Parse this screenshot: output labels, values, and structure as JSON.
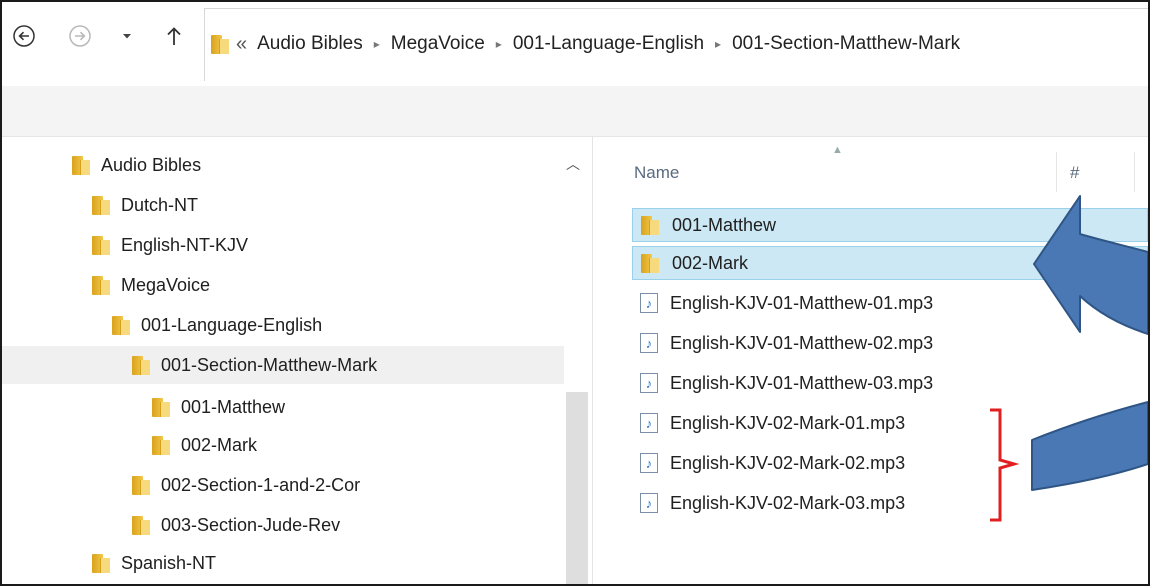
{
  "window": {
    "address": {
      "overflow_chevrons": "«",
      "crumbs": [
        "Audio Bibles",
        "MegaVoice",
        "001-Language-English",
        "001-Section-Matthew-Mark"
      ],
      "separator": "▸"
    }
  },
  "nav": {
    "back_icon": "back-arrow-icon",
    "forward_icon": "forward-arrow-icon",
    "recent_icon": "chevron-down-icon",
    "up_icon": "up-arrow-icon"
  },
  "tree": {
    "items": [
      {
        "label": "Audio Bibles",
        "level": 0
      },
      {
        "label": "Dutch-NT",
        "level": 1
      },
      {
        "label": "English-NT-KJV",
        "level": 1
      },
      {
        "label": "MegaVoice",
        "level": 1
      },
      {
        "label": "001-Language-English",
        "level": 2
      },
      {
        "label": "001-Section-Matthew-Mark",
        "level": 3,
        "selected": true
      },
      {
        "label": "001-Matthew",
        "level": 4
      },
      {
        "label": "002-Mark",
        "level": 4
      },
      {
        "label": "002-Section-1-and-2-Cor",
        "level": 3
      },
      {
        "label": "003-Section-Jude-Rev",
        "level": 3
      },
      {
        "label": "Spanish-NT",
        "level": 1
      }
    ]
  },
  "filelist": {
    "columns": {
      "name": "Name",
      "number": "#"
    },
    "rows": [
      {
        "name": "001-Matthew",
        "type": "folder",
        "highlighted": true
      },
      {
        "name": "002-Mark",
        "type": "folder",
        "highlighted": true
      },
      {
        "name": "English-KJV-01-Matthew-01.mp3",
        "type": "mp3"
      },
      {
        "name": "English-KJV-01-Matthew-02.mp3",
        "type": "mp3"
      },
      {
        "name": "English-KJV-01-Matthew-03.mp3",
        "type": "mp3"
      },
      {
        "name": "English-KJV-02-Mark-01.mp3",
        "type": "mp3"
      },
      {
        "name": "English-KJV-02-Mark-02.mp3",
        "type": "mp3"
      },
      {
        "name": "English-KJV-02-Mark-03.mp3",
        "type": "mp3"
      }
    ]
  },
  "annotation": {
    "arrow_color": "#4a78b4",
    "arrow_outline": "#2f5585",
    "bracket_color": "#e02020"
  }
}
